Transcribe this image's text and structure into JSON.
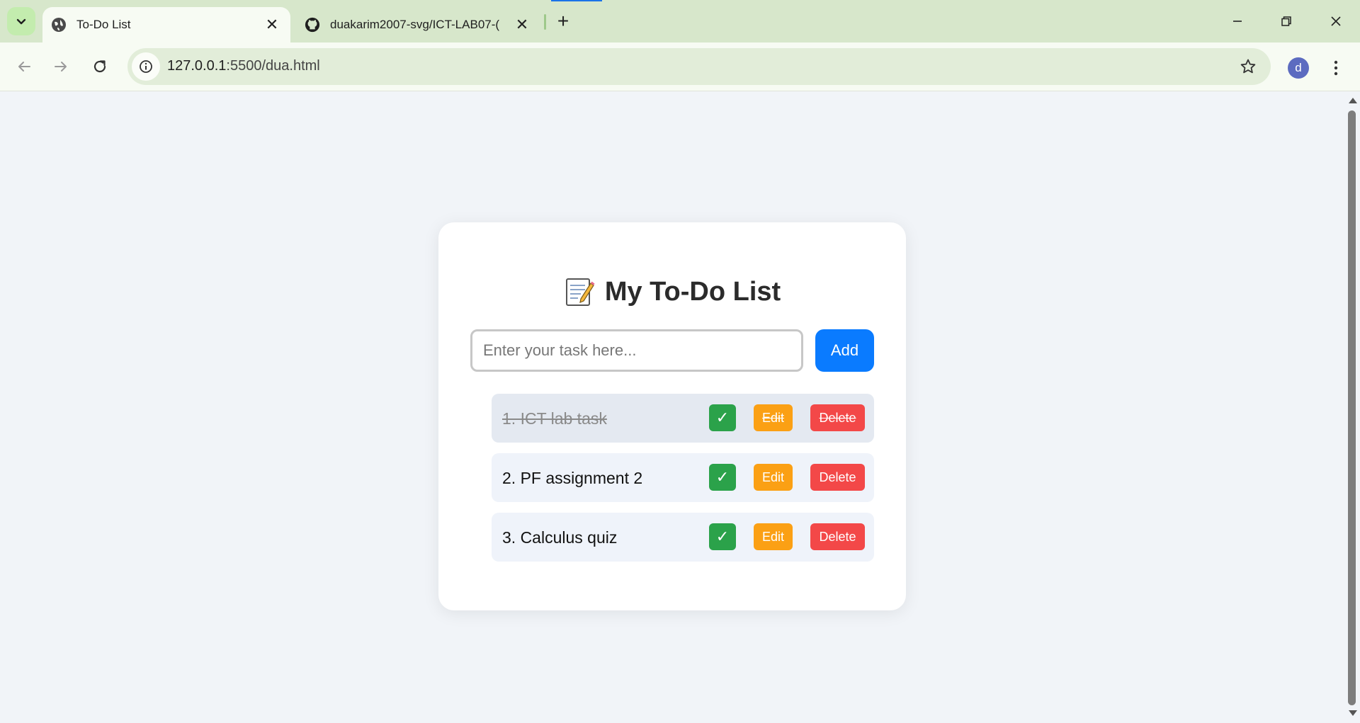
{
  "browser": {
    "tabs": [
      {
        "title": "To-Do List",
        "active": true,
        "icon": "globe-icon"
      },
      {
        "title": "duakarim2007-svg/ICT-LAB07-(",
        "active": false,
        "icon": "github-icon"
      }
    ],
    "url_host": "127.0.0.1",
    "url_path": ":5500/dua.html",
    "profile_initial": "d"
  },
  "app": {
    "title": "My To-Do List",
    "input_placeholder": "Enter your task here...",
    "input_value": "",
    "add_label": "Add",
    "complete_label": "✓",
    "edit_label": "Edit",
    "delete_label": "Delete",
    "tasks": [
      {
        "text": "1. ICT lab task",
        "done": true
      },
      {
        "text": "2. PF assignment 2",
        "done": false
      },
      {
        "text": "3. Calculus quiz",
        "done": false
      }
    ]
  },
  "colors": {
    "accent": "#0a7bff",
    "complete": "#2ba24a",
    "edit": "#fba014",
    "delete": "#f34848"
  }
}
